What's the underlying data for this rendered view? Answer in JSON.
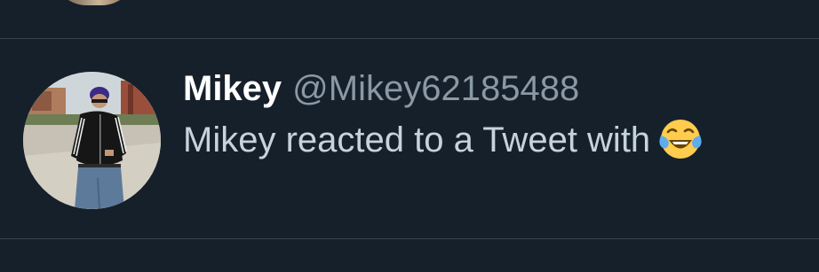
{
  "notification": {
    "display_name": "Mikey",
    "handle": "@Mikey62185488",
    "reaction_text": "Mikey reacted to a Tweet with",
    "reaction_emoji": "face-with-tears-of-joy"
  },
  "colors": {
    "background": "#15202b",
    "divider": "#38444d",
    "name": "#ffffff",
    "handle": "#8b98a5",
    "body_text": "#c6d3de"
  }
}
